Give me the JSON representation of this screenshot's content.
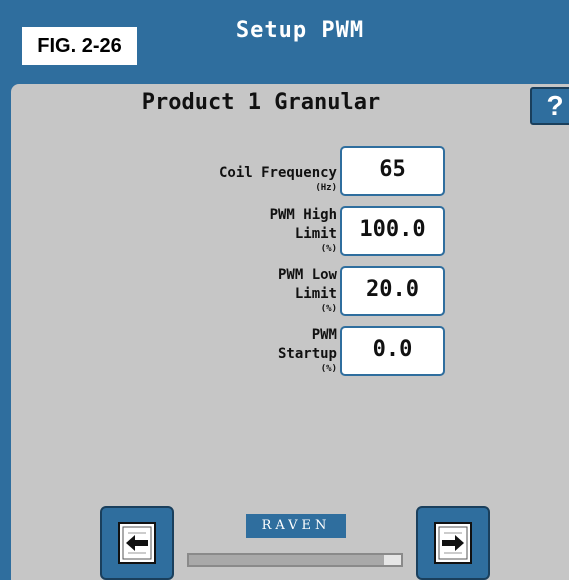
{
  "window": {
    "title": "Setup PWM"
  },
  "figure_label": "FIG. 2-26",
  "heading": "Product 1 Granular",
  "help_button": "?",
  "fields": [
    {
      "label_lines": [
        "Coil Frequency"
      ],
      "unit": "(Hz)",
      "value": "65"
    },
    {
      "label_lines": [
        "PWM High",
        "Limit"
      ],
      "unit": "(%)",
      "value": "100.0"
    },
    {
      "label_lines": [
        "PWM Low",
        "Limit"
      ],
      "unit": "(%)",
      "value": "20.0"
    },
    {
      "label_lines": [
        "PWM",
        "Startup"
      ],
      "unit": "(%)",
      "value": "0.0"
    }
  ],
  "logo_text": "RAVEN",
  "progress_fraction": 0.92,
  "colors": {
    "accent": "#2f6e9e",
    "panel": "#c6c6c6"
  },
  "icons": {
    "back": "back-arrow-icon",
    "next": "next-arrow-icon",
    "help": "help-icon"
  }
}
